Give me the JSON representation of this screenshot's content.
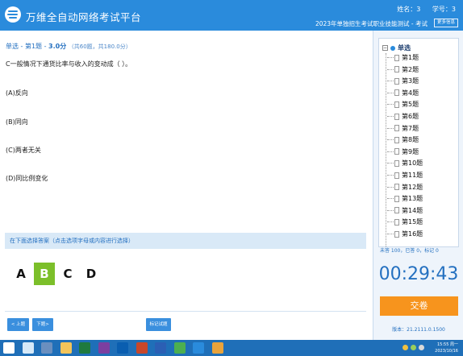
{
  "header": {
    "app_title": "万维全自动网络考试平台",
    "name_label": "姓名：3",
    "id_label": "学号：3",
    "exam_title": "2023年单独招生考试职业技能测试 - 考试",
    "change_button": "更多信息"
  },
  "question": {
    "header": "单选 - 第1题 - ",
    "score": "3.0分",
    "count": "（共60题，共180.0分）",
    "text": "C一般情况下通货比率与收入的变动成（  ）。",
    "options": [
      "(A)反向",
      "(B)同向",
      "(C)两者无关",
      "(D)同比例变化"
    ]
  },
  "answer": {
    "prompt": "在下面选择答案（点击选项字母或内容进行选择）",
    "letters": [
      "A",
      "B",
      "C",
      "D"
    ],
    "selected": "B"
  },
  "nav": {
    "prev": "< 上题",
    "next": "下题>",
    "mark": "标记试题"
  },
  "tree": {
    "root": "单选",
    "items": [
      "第1题",
      "第2题",
      "第3题",
      "第4题",
      "第5题",
      "第6题",
      "第7题",
      "第8题",
      "第9题",
      "第10题",
      "第11题",
      "第12题",
      "第13题",
      "第14题",
      "第15题",
      "第16题"
    ]
  },
  "stats": "未答 100，已答 0，标记 0",
  "timer": "00:29:43",
  "submit": "交卷",
  "version": "版本：21.2111.0.1500",
  "clock": {
    "time": "15:55 周一",
    "date": "2023/10/16"
  },
  "colors": {
    "accent": "#2a8bdc",
    "selected": "#7cbf2a",
    "submit": "#f7941d",
    "taskbar": "#1f6fb8"
  },
  "taskbar_icons": [
    "windows-icon",
    "file-explorer-icon",
    "media-icon",
    "folder-icon",
    "excel-icon",
    "onenote-icon",
    "outlook-icon",
    "powerpoint-icon",
    "word-icon",
    "browser-icon",
    "app-s-icon",
    "app-c-icon"
  ]
}
